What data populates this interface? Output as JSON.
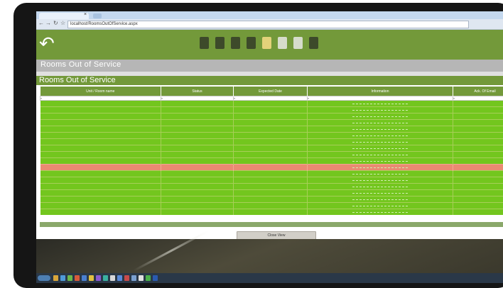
{
  "browser": {
    "address": "localhost/RoomsOutOfService.aspx"
  },
  "app": {
    "page_title": "Rooms Out of Service",
    "panel_title": "Rooms Out of Service",
    "accent_color": "#73993a",
    "status_colors": {
      "ok": "#73c61e",
      "alert": "#ea8a72"
    },
    "toolbar_icons": [
      "maintenance-icon",
      "tools-icon",
      "rooms-icon",
      "documents-icon",
      "flags-icon",
      "reports-icon",
      "edit-icon",
      "device-icon"
    ]
  },
  "table": {
    "columns": [
      "Unit / Room name",
      "Status",
      "Expected Date",
      "Information",
      "Ack. Of Email"
    ],
    "rows": [
      {
        "status_color": "green"
      },
      {
        "status_color": "green"
      },
      {
        "status_color": "green"
      },
      {
        "status_color": "green"
      },
      {
        "status_color": "green"
      },
      {
        "status_color": "green"
      },
      {
        "status_color": "green"
      },
      {
        "status_color": "green"
      },
      {
        "status_color": "green"
      },
      {
        "status_color": "green"
      },
      {
        "status_color": "red"
      },
      {
        "status_color": "green"
      },
      {
        "status_color": "green"
      },
      {
        "status_color": "green"
      },
      {
        "status_color": "green"
      },
      {
        "status_color": "green"
      },
      {
        "status_color": "green"
      },
      {
        "status_color": "green"
      }
    ]
  },
  "actions": {
    "view_button": "Close View"
  }
}
